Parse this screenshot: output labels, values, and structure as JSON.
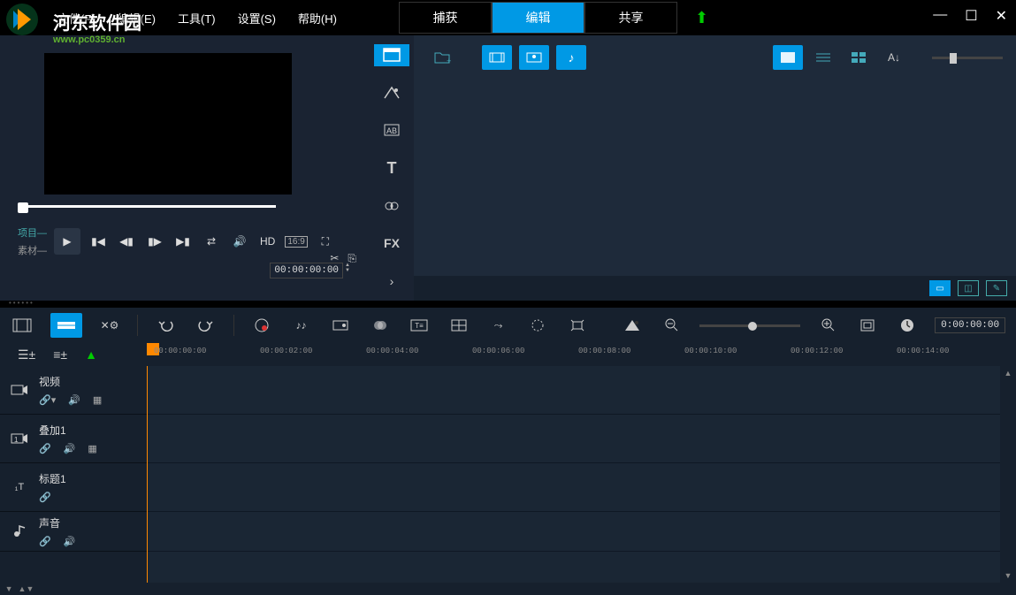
{
  "menu": {
    "file": "文件(F)",
    "edit": "编辑(E)",
    "tools": "工具(T)",
    "settings": "设置(S)",
    "help": "帮助(H)"
  },
  "tabs": {
    "capture": "捕获",
    "edit": "编辑",
    "share": "共享"
  },
  "watermark": {
    "title": "河东软件园",
    "url": "www.pc0359.cn"
  },
  "preview": {
    "project_label": "项目",
    "clip_label": "素材",
    "hd": "HD",
    "aspect": "16:9",
    "timecode": "00:00:00:00"
  },
  "library_sidebar": {
    "fx_label": "FX"
  },
  "timeline_toolbar": {
    "timecode": "0:00:00:00"
  },
  "ruler": {
    "marks": [
      "00:00:00:00",
      "00:00:02:00",
      "00:00:04:00",
      "00:00:06:00",
      "00:00:08:00",
      "00:00:10:00",
      "00:00:12:00",
      "00:00:14:00"
    ]
  },
  "tracks": {
    "video": "视频",
    "overlay": "叠加1",
    "title": "标题1",
    "audio": "声音"
  }
}
